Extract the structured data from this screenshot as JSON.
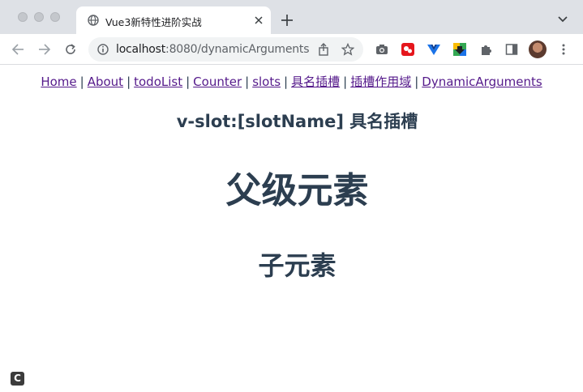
{
  "tab": {
    "title": "Vue3新特性进阶实战"
  },
  "address": {
    "host": "localhost",
    "path": ":8080/dynamicArguments"
  },
  "nav": {
    "links": [
      "Home",
      "About",
      "todoList",
      "Counter",
      "slots",
      "具名插槽",
      "插槽作用域",
      "DynamicArguments"
    ],
    "separator": "|"
  },
  "page": {
    "slot_heading": "v-slot:[slotName] 具名插槽",
    "parent_heading": "父级元素",
    "child_heading": "子元素"
  },
  "badge": {
    "letter": "C"
  },
  "icons": {
    "tab_favicon": "globe-icon",
    "close": "close-icon",
    "new_tab": "plus-icon",
    "info": "info-icon",
    "share": "share-icon",
    "bookmark": "star-icon",
    "camera": "camera-icon",
    "extensions": "puzzle-icon"
  },
  "colors": {
    "link": "#551a8b",
    "text": "#2c3e50",
    "tabstrip": "#dee1e6"
  }
}
